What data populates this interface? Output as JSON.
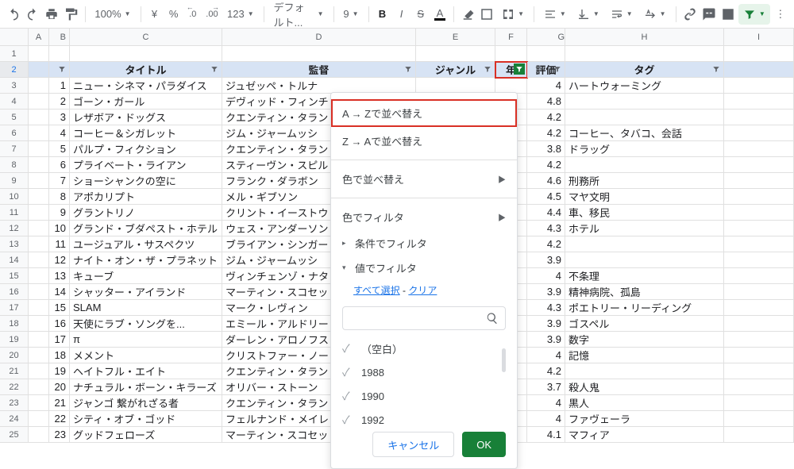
{
  "toolbar": {
    "zoom": "100%",
    "currency": "¥",
    "percent": "%",
    "dec_dec": ".0",
    "dec_inc": ".00",
    "numfmt": "123",
    "font": "デフォルト...",
    "font_size": "9"
  },
  "columns": [
    "A",
    "B",
    "C",
    "D",
    "E",
    "F",
    "G",
    "H",
    "I"
  ],
  "headers": {
    "B": "",
    "C": "タイトル",
    "D": "監督",
    "E": "ジャンル",
    "F": "年",
    "G": "評価",
    "H": "タグ"
  },
  "rows": [
    {
      "n": 1,
      "title": "ニュー・シネマ・パラダイス",
      "dir": "ジュゼッペ・トルナ",
      "rating": "4",
      "tag": "ハートウォーミング"
    },
    {
      "n": 2,
      "title": "ゴーン・ガール",
      "dir": "デヴィッド・フィンチ",
      "rating": "4.8",
      "tag": ""
    },
    {
      "n": 3,
      "title": "レザボア・ドッグス",
      "dir": "クエンティン・タラン",
      "rating": "4.2",
      "tag": ""
    },
    {
      "n": 4,
      "title": "コーヒー＆シガレット",
      "dir": "ジム・ジャームッシ",
      "rating": "4.2",
      "tag": "コーヒー、タバコ、会話"
    },
    {
      "n": 5,
      "title": "パルプ・フィクション",
      "dir": "クエンティン・タラン",
      "rating": "3.8",
      "tag": "ドラッグ"
    },
    {
      "n": 6,
      "title": "プライベート・ライアン",
      "dir": "スティーヴン・スピル",
      "rating": "4.2",
      "tag": ""
    },
    {
      "n": 7,
      "title": "ショーシャンクの空に",
      "dir": "フランク・ダラボン",
      "rating": "4.6",
      "tag": "刑務所"
    },
    {
      "n": 8,
      "title": "アポカリプト",
      "dir": "メル・ギブソン",
      "rating": "4.5",
      "tag": "マヤ文明"
    },
    {
      "n": 9,
      "title": "グラントリノ",
      "dir": "クリント・イーストウ",
      "rating": "4.4",
      "tag": "車、移民"
    },
    {
      "n": 10,
      "title": "グランド・ブダペスト・ホテル",
      "dir": "ウェス・アンダーソン",
      "rating": "4.3",
      "tag": "ホテル"
    },
    {
      "n": 11,
      "title": "ユージュアル・サスペクツ",
      "dir": "ブライアン・シンガー",
      "rating": "4.2",
      "tag": ""
    },
    {
      "n": 12,
      "title": "ナイト・オン・ザ・プラネット",
      "dir": "ジム・ジャームッシ",
      "rating": "3.9",
      "tag": ""
    },
    {
      "n": 13,
      "title": "キューブ",
      "dir": "ヴィンチェンゾ・ナタ",
      "rating": "4",
      "tag": "不条理"
    },
    {
      "n": 14,
      "title": "シャッター・アイランド",
      "dir": "マーティン・スコセッ",
      "rating": "3.9",
      "tag": "精神病院、孤島"
    },
    {
      "n": 15,
      "title": "SLAM",
      "dir": "マーク・レヴィン",
      "rating": "4.3",
      "tag": "ポエトリー・リーディング"
    },
    {
      "n": 16,
      "title": "天使にラブ・ソングを...",
      "dir": "エミール・アルドリー",
      "rating": "3.9",
      "tag": "ゴスペル"
    },
    {
      "n": 17,
      "title": "π",
      "dir": "ダーレン・アロノフス",
      "rating": "3.9",
      "tag": "数字"
    },
    {
      "n": 18,
      "title": "メメント",
      "dir": "クリストファー・ノー",
      "rating": "4",
      "tag": "記憶"
    },
    {
      "n": 19,
      "title": "ヘイトフル・エイト",
      "dir": "クエンティン・タラン",
      "rating": "4.2",
      "tag": ""
    },
    {
      "n": 20,
      "title": "ナチュラル・ボーン・キラーズ",
      "dir": "オリバー・ストーン",
      "rating": "3.7",
      "tag": "殺人鬼"
    },
    {
      "n": 21,
      "title": "ジャンゴ 繋がれざる者",
      "dir": "クエンティン・タラン",
      "rating": "4",
      "tag": "黒人"
    },
    {
      "n": 22,
      "title": "シティ・オブ・ゴッド",
      "dir": "フェルナンド・メイレ",
      "rating": "4",
      "tag": "ファヴェーラ"
    },
    {
      "n": 23,
      "title": "グッドフェローズ",
      "dir": "マーティン・スコセッ",
      "rating": "4.1",
      "tag": "マフィア"
    }
  ],
  "filter_popup": {
    "sort_az": "A → Zで並べ替え",
    "sort_za": "Z → Aで並べ替え",
    "sort_color": "色で並べ替え",
    "filter_color": "色でフィルタ",
    "filter_cond": "条件でフィルタ",
    "filter_value": "値でフィルタ",
    "select_all": "すべて選択",
    "clear": "クリア",
    "blank": "（空白）",
    "values": [
      "1988",
      "1990",
      "1992"
    ],
    "cancel": "キャンセル",
    "ok": "OK"
  }
}
